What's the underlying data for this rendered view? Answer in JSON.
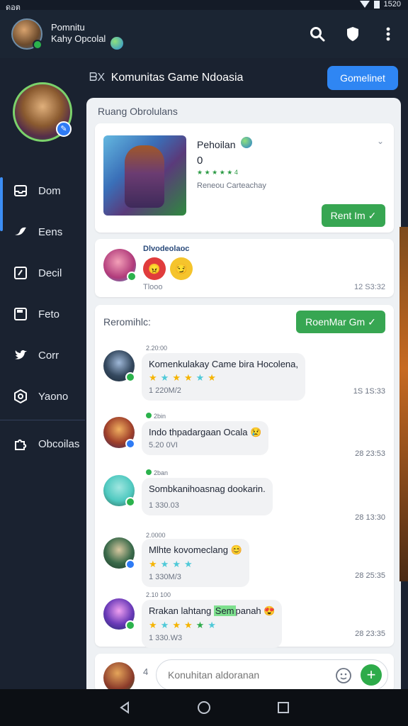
{
  "status": {
    "left": "ดอต",
    "time": "1520"
  },
  "header": {
    "title_line1": "Pomnitu",
    "title_line2": "Kahy Opcolal",
    "icons": [
      "search-icon",
      "shield-heart-icon",
      "more-vertical-icon"
    ]
  },
  "sidebar": {
    "items": [
      {
        "label": "Dom",
        "icon": "inbox-icon"
      },
      {
        "label": "Eens",
        "icon": "bird-icon"
      },
      {
        "label": "Decil",
        "icon": "edit-box-icon"
      },
      {
        "label": "Feto",
        "icon": "save-icon"
      },
      {
        "label": "Corr",
        "icon": "twitter-icon"
      },
      {
        "label": "Yaono",
        "icon": "hexagon-icon"
      },
      {
        "label": "Obcoilas",
        "icon": "puzzle-icon"
      }
    ]
  },
  "main": {
    "header_prefix": "ᗷX",
    "header_title": "Komunitas Game Ndoasia",
    "header_button": "Gomelinet",
    "panel_title": "Ruang Obrolulans"
  },
  "profile_card": {
    "name": "Pehoilan",
    "number": "0",
    "mini_rating": "★ ★ ★ ★ ★ 4",
    "subtitle": "Reneou Carteachay",
    "button": "Rent Im ✓"
  },
  "reaction_card": {
    "title": "Dlvodeolaoc",
    "reaction1": "😠",
    "reaction2": "😏",
    "label": "Tlooo",
    "time": "12 S3:32"
  },
  "feed": {
    "label": "Reromihlc:",
    "button": "RoenMar Gm ✓",
    "messages": [
      {
        "meta": "2.20:00",
        "text": "Komenkulakay Came bira Hocolena,",
        "stars": "★★★★★★",
        "stat": "1 220M/2",
        "time": "1S 1S:33"
      },
      {
        "meta": "2bin",
        "text": "Indo thpadargaan Ocala 😢",
        "stars": "",
        "stat": "5.20 0VI",
        "time": "28 23:53"
      },
      {
        "meta": "2ban",
        "text": "Sombkanihoasnag dookarin.",
        "stars": "",
        "stat": "1 330.03",
        "time": "28 13:30"
      },
      {
        "meta": "2.0000",
        "text": "Mlhte kovomeclang 😊",
        "stars": "★★★★",
        "stat": "1 330M/3",
        "time": "28 25:35"
      },
      {
        "meta": "2.10 100",
        "text_pre": "Rrakan lahtang ",
        "text_hl": "Sem",
        "text_post": "panah 😍",
        "stars": "★★★★★★",
        "stat": "1 330.W3",
        "time": "28 23:35"
      }
    ]
  },
  "composer": {
    "quote": "4",
    "placeholder": "Konuhitan aldoranan"
  },
  "colors": {
    "accent_blue": "#2f86f3",
    "accent_green": "#37a652",
    "panel_bg": "#eef1f4",
    "sidebar_bg": "#1a2230"
  }
}
